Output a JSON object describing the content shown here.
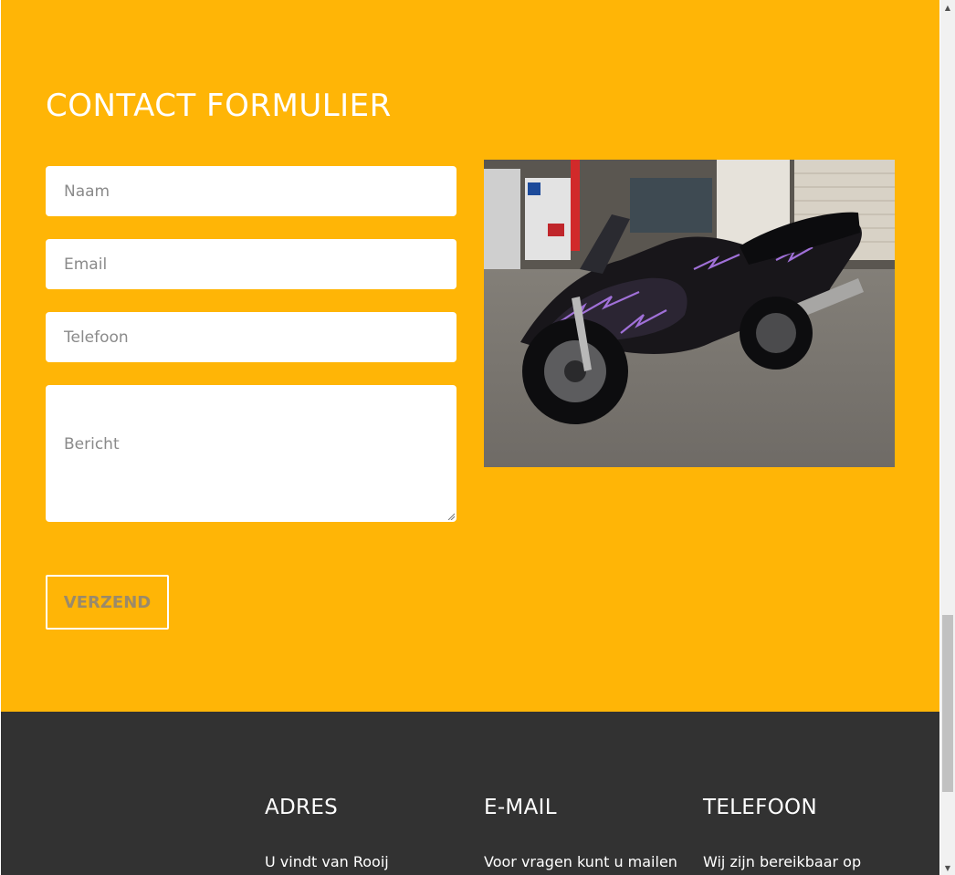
{
  "contact": {
    "title": "CONTACT FORMULIER",
    "fields": {
      "naam_placeholder": "Naam",
      "email_placeholder": "Email",
      "telefoon_placeholder": "Telefoon",
      "bericht_placeholder": "Bericht"
    },
    "submit_label": "VERZEND",
    "background_color": "#ffb506",
    "image": "motorcycle-photo"
  },
  "footer": {
    "background_color": "#323232",
    "columns": [
      {
        "heading": "ADRES",
        "text": "U vindt van Rooij"
      },
      {
        "heading": "E-MAIL",
        "text": "Voor vragen kunt u mailen"
      },
      {
        "heading": "TELEFOON",
        "text": "Wij zijn bereikbaar op"
      }
    ]
  },
  "scrollbar": {
    "up_icon": "arrow-up-icon",
    "down_icon": "arrow-down-icon"
  }
}
